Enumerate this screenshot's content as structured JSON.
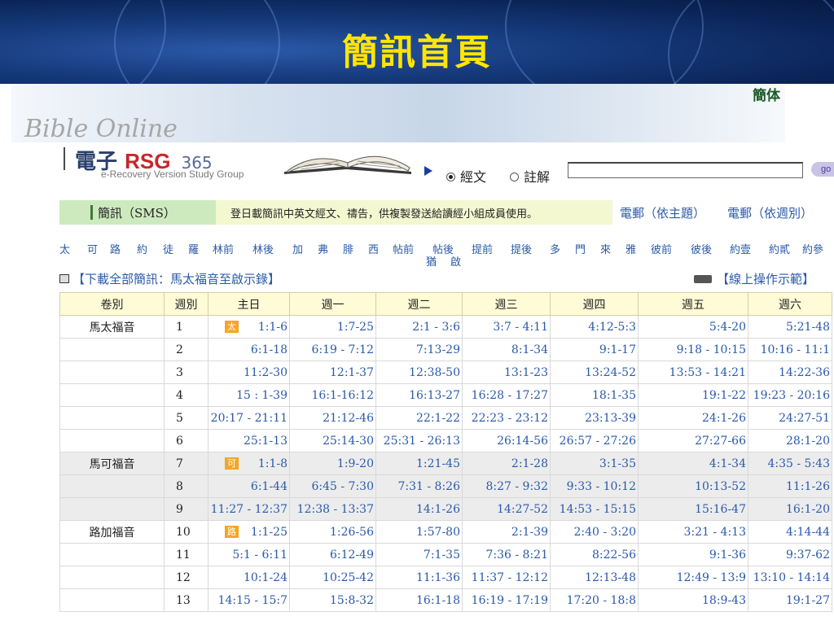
{
  "slide": {
    "title": "簡訊首頁"
  },
  "banner": {
    "script_text": "Bible Online",
    "simplified_link": "簡体"
  },
  "logo": {
    "main": "電子",
    "rsg": "RSG",
    "suffix": "365",
    "subtitle": "e-Recovery Version Study Group"
  },
  "search": {
    "options": [
      {
        "label": "經文",
        "selected": true
      },
      {
        "label": "註解",
        "selected": false
      }
    ],
    "input_value": "",
    "go_label": "go"
  },
  "sms": {
    "tag": "簡訊（SMS）",
    "description": "登日載簡訊中英文經文、禱告，供複製發送給讀經小組成員使用。",
    "mail_by_topic": "電郵（依主題）",
    "mail_by_week": "電郵（依週別）"
  },
  "book_nav": [
    "太",
    "可",
    "路",
    "約",
    "徒",
    "羅",
    "林前",
    "林後",
    "加",
    "弗",
    "腓",
    "西",
    "帖前",
    "帖後",
    "提前",
    "提後",
    "多",
    "門",
    "來",
    "雅",
    "彼前",
    "彼後",
    "約壹",
    "約貳",
    "約參"
  ],
  "book_nav_extra": [
    "猶",
    "啟"
  ],
  "download": {
    "label": "【下載全部簡訊：馬太福音至啟示錄】"
  },
  "demo": {
    "label": "【線上操作示範】"
  },
  "table": {
    "headers": [
      "卷別",
      "週別",
      "主日",
      "週一",
      "週二",
      "週三",
      "週四",
      "週五",
      "週六"
    ],
    "rows": [
      {
        "book": "馬太福音",
        "week": "1",
        "tag": "太",
        "cells": [
          "1:1-6",
          "1:7-25",
          "2:1 - 3:6",
          "3:7 - 4:11",
          "4:12-5:3",
          "5:4-20",
          "5:21-48"
        ]
      },
      {
        "book": "",
        "week": "2",
        "tag": "",
        "cells": [
          "6:1-18",
          "6:19 - 7:12",
          "7:13-29",
          "8:1-34",
          "9:1-17",
          "9:18 - 10:15",
          "10:16 - 11:1"
        ]
      },
      {
        "book": "",
        "week": "3",
        "tag": "",
        "cells": [
          "11:2-30",
          "12:1-37",
          "12:38-50",
          "13:1-23",
          "13:24-52",
          "13:53 - 14:21",
          "14:22-36"
        ]
      },
      {
        "book": "",
        "week": "4",
        "tag": "",
        "cells": [
          "15 : 1-39",
          "16:1-16:12",
          "16:13-27",
          "16:28 - 17:27",
          "18:1-35",
          "19:1-22",
          "19:23 - 20:16"
        ]
      },
      {
        "book": "",
        "week": "5",
        "tag": "",
        "cells": [
          "20:17 - 21:11",
          "21:12-46",
          "22:1-22",
          "22:23 - 23:12",
          "23:13-39",
          "24:1-26",
          "24:27-51"
        ]
      },
      {
        "book": "",
        "week": "6",
        "tag": "",
        "cells": [
          "25:1-13",
          "25:14-30",
          "25:31 - 26:13",
          "26:14-56",
          "26:57 - 27:26",
          "27:27-66",
          "28:1-20"
        ]
      },
      {
        "book": "馬可福音",
        "week": "7",
        "tag": "可",
        "cells": [
          "1:1-8",
          "1:9-20",
          "1:21-45",
          "2:1-28",
          "3:1-35",
          "4:1-34",
          "4:35 - 5:43"
        ]
      },
      {
        "book": "",
        "week": "8",
        "tag": "",
        "cells": [
          "6:1-44",
          "6:45 - 7:30",
          "7:31 - 8:26",
          "8:27 - 9:32",
          "9:33 - 10:12",
          "10:13-52",
          "11:1-26"
        ]
      },
      {
        "book": "",
        "week": "9",
        "tag": "",
        "cells": [
          "11:27 - 12:37",
          "12:38 - 13:37",
          "14:1-26",
          "14:27-52",
          "14:53 - 15:15",
          "15:16-47",
          "16:1-20"
        ]
      },
      {
        "book": "路加福音",
        "week": "10",
        "tag": "路",
        "cells": [
          "1:1-25",
          "1:26-56",
          "1:57-80",
          "2:1-39",
          "2:40 - 3:20",
          "3:21 - 4:13",
          "4:14-44"
        ]
      },
      {
        "book": "",
        "week": "11",
        "tag": "",
        "cells": [
          "5:1 - 6:11",
          "6:12-49",
          "7:1-35",
          "7:36 - 8:21",
          "8:22-56",
          "9:1-36",
          "9:37-62"
        ]
      },
      {
        "book": "",
        "week": "12",
        "tag": "",
        "cells": [
          "10:1-24",
          "10:25-42",
          "11:1-36",
          "11:37 - 12:12",
          "12:13-48",
          "12:49 - 13:9",
          "13:10 - 14:14"
        ]
      },
      {
        "book": "",
        "week": "13",
        "tag": "",
        "cells": [
          "14:15 - 15:7",
          "15:8-32",
          "16:1-18",
          "16:19 - 17:19",
          "17:20 - 18:8",
          "18:9-43",
          "19:1-27"
        ]
      }
    ],
    "shaded_rows": [
      6,
      7,
      8
    ]
  },
  "colors": {
    "title": "#ffe600",
    "link": "#2a5aaa",
    "header_bg": "#fefbd6",
    "tag_bg": "#f5a623",
    "sms_bg": "#f3f8d0"
  }
}
